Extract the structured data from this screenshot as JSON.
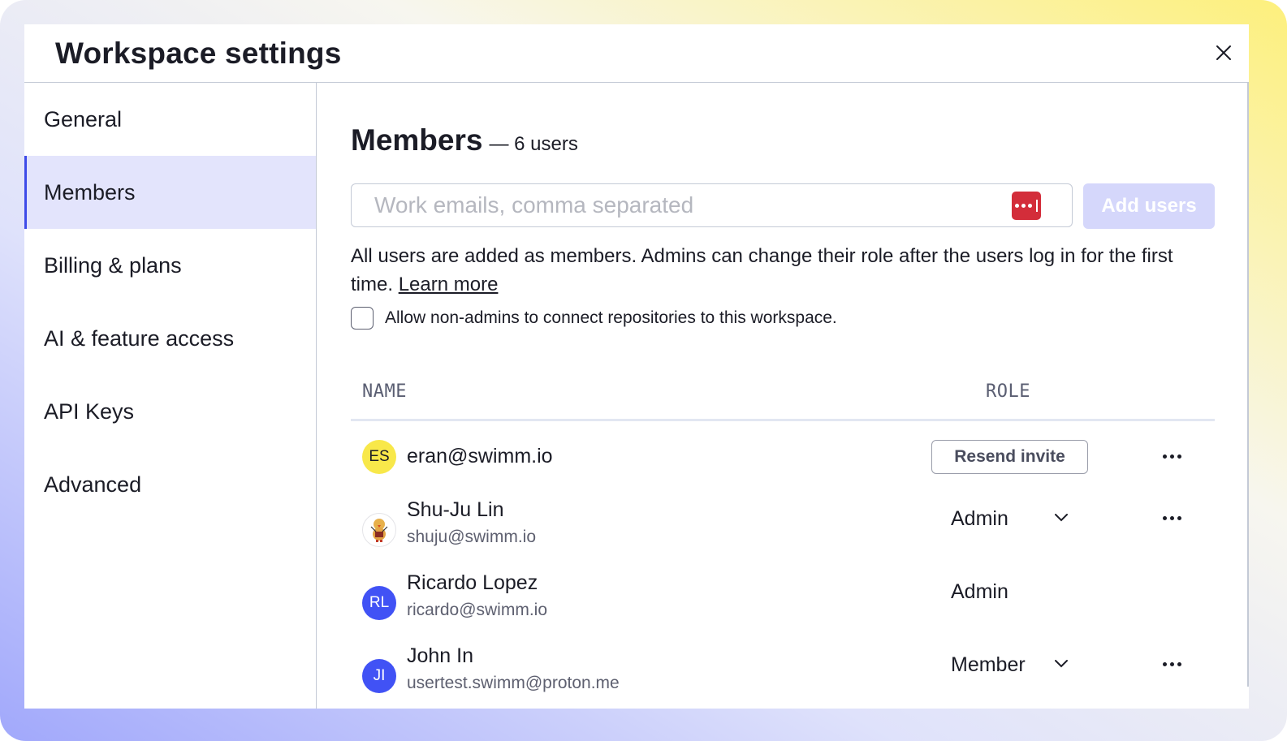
{
  "modal": {
    "title": "Workspace settings"
  },
  "sidebar": {
    "items": [
      {
        "label": "General",
        "active": false
      },
      {
        "label": "Members",
        "active": true
      },
      {
        "label": "Billing & plans",
        "active": false
      },
      {
        "label": "AI & feature access",
        "active": false
      },
      {
        "label": "API Keys",
        "active": false
      },
      {
        "label": "Advanced",
        "active": false
      }
    ]
  },
  "main": {
    "title": "Members",
    "count_label": "— 6 users",
    "email_input": {
      "value": "",
      "placeholder": "Work emails, comma separated"
    },
    "add_button_label": "Add users",
    "info_text": "All users are added as members. Admins can change their role after the users log in for the first time.",
    "learn_more_label": "Learn more",
    "checkbox": {
      "label": "Allow non-admins to connect repositories to this workspace.",
      "checked": false
    },
    "table": {
      "headers": {
        "name": "NAME",
        "role": "ROLE"
      },
      "rows": [
        {
          "initials": "ES",
          "avatar_color": "#f8e84a",
          "name": "eran@swimm.io",
          "email": "",
          "role": "",
          "action": "Resend invite",
          "has_dropdown": false,
          "has_more": true
        },
        {
          "initials": "",
          "avatar_type": "image-duck",
          "name": "Shu-Ju Lin",
          "email": "shuju@swimm.io",
          "role": "Admin",
          "has_dropdown": true,
          "has_more": true
        },
        {
          "initials": "RL",
          "avatar_color": "#4152f5",
          "name": "Ricardo Lopez",
          "email": "ricardo@swimm.io",
          "role": "Admin",
          "has_dropdown": false,
          "has_more": false
        },
        {
          "initials": "JI",
          "avatar_color": "#4152f5",
          "name": "John In",
          "email": "usertest.swimm@proton.me",
          "role": "Member",
          "has_dropdown": true,
          "has_more": true
        }
      ]
    }
  },
  "colors": {
    "accent": "#3e4be8",
    "active_bg": "#e3e4fc",
    "add_button_disabled": "#d5d7fb",
    "password_manager": "#d32d3a"
  }
}
